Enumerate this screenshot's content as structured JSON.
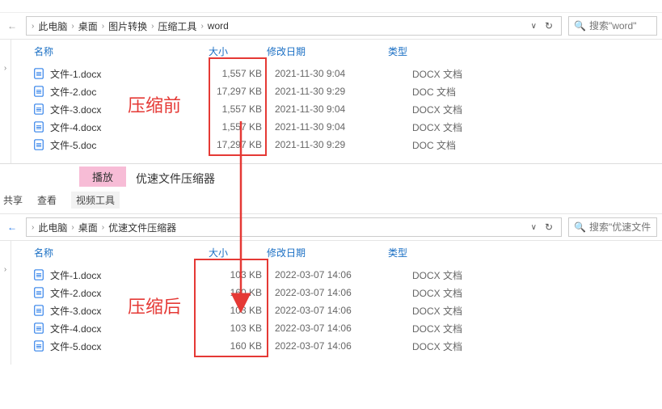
{
  "topbar": {
    "item1": "",
    "item2": ""
  },
  "window1": {
    "breadcrumb": {
      "c1": "此电脑",
      "c2": "桌面",
      "c3": "图片转换",
      "c4": "压缩工具",
      "c5": "word"
    },
    "search_placeholder": "搜索\"word\"",
    "headers": {
      "name": "名称",
      "size": "大小",
      "date": "修改日期",
      "type": "类型"
    },
    "files": [
      {
        "name": "文件-1.docx",
        "size": "1,557 KB",
        "date": "2021-11-30 9:04",
        "type": "DOCX 文档"
      },
      {
        "name": "文件-2.doc",
        "size": "17,297 KB",
        "date": "2021-11-30 9:29",
        "type": "DOC 文档"
      },
      {
        "name": "文件-3.docx",
        "size": "1,557 KB",
        "date": "2021-11-30 9:04",
        "type": "DOCX 文档"
      },
      {
        "name": "文件-4.docx",
        "size": "1,557 KB",
        "date": "2021-11-30 9:04",
        "type": "DOCX 文档"
      },
      {
        "name": "文件-5.doc",
        "size": "17,297 KB",
        "date": "2021-11-30 9:29",
        "type": "DOC 文档"
      }
    ],
    "annotation": "压缩前"
  },
  "mid": {
    "play": "播放",
    "tool_title": "优速文件压缩器",
    "menu": {
      "share": "共享",
      "view": "查看",
      "video_tool": "视频工具"
    }
  },
  "window2": {
    "breadcrumb": {
      "c1": "此电脑",
      "c2": "桌面",
      "c3": "优速文件压缩器"
    },
    "search_placeholder": "搜索\"优速文件",
    "headers": {
      "name": "名称",
      "size": "大小",
      "date": "修改日期",
      "type": "类型"
    },
    "files": [
      {
        "name": "文件-1.docx",
        "size": "103 KB",
        "date": "2022-03-07 14:06",
        "type": "DOCX 文档"
      },
      {
        "name": "文件-2.docx",
        "size": "160 KB",
        "date": "2022-03-07 14:06",
        "type": "DOCX 文档"
      },
      {
        "name": "文件-3.docx",
        "size": "103 KB",
        "date": "2022-03-07 14:06",
        "type": "DOCX 文档"
      },
      {
        "name": "文件-4.docx",
        "size": "103 KB",
        "date": "2022-03-07 14:06",
        "type": "DOCX 文档"
      },
      {
        "name": "文件-5.docx",
        "size": "160 KB",
        "date": "2022-03-07 14:06",
        "type": "DOCX 文档"
      }
    ],
    "annotation": "压缩后"
  },
  "colors": {
    "accent": "#1a6fc4",
    "highlight": "#e53935",
    "pink": "#f7bcd6"
  }
}
